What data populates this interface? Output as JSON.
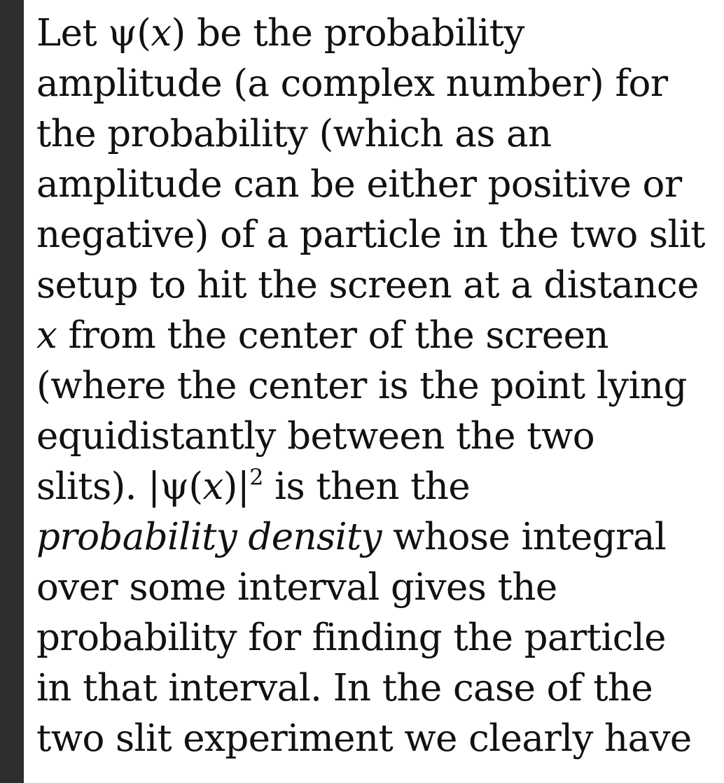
{
  "lines": {
    "l1": {
      "a": "Let ψ(",
      "b": "x",
      "c": ") be the probability"
    },
    "l2": "amplitude (a complex number) for",
    "l3": "the probability (which as an",
    "l4": "amplitude can be either positive or",
    "l5": "negative) of a particle in the two slit",
    "l6": "setup to hit the screen at a distance",
    "l7": {
      "a": "x",
      "b": " from the center of the screen"
    },
    "l8": "(where the center is the point lying",
    "l9": "equidistantly between the two",
    "l10": {
      "a": "slits). |ψ(",
      "b": "x",
      "c": ")|",
      "sup": "2",
      "d": " is then the"
    },
    "l11": {
      "a": "probability density",
      "b": " whose integral"
    },
    "l12": "over some interval gives the",
    "l13": "probability for finding the particle",
    "l14": "in that interval. In the case of the",
    "l15": "two slit experiment we clearly have"
  }
}
